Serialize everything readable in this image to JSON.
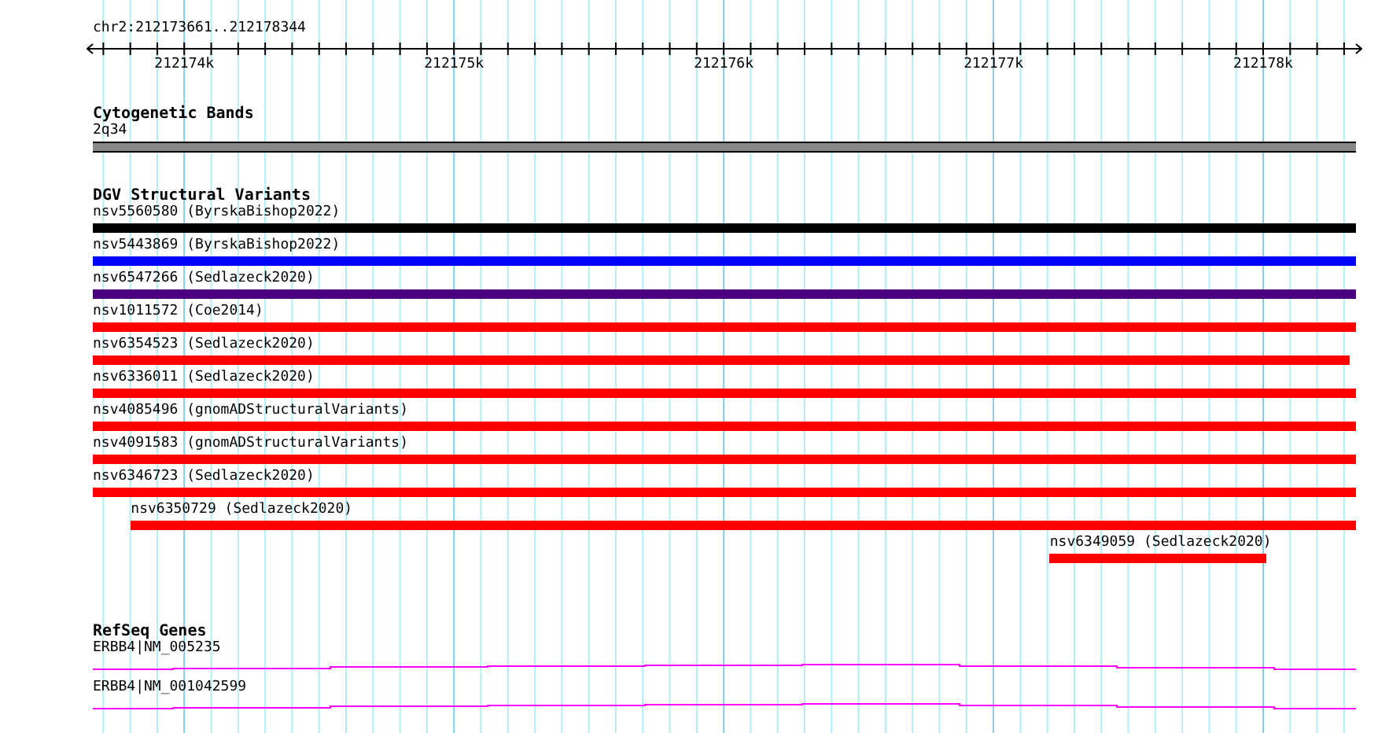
{
  "ruler": {
    "location": "chr2:212173661..212178344",
    "tick_labels": [
      "212174k",
      "212175k",
      "212176k",
      "212177k",
      "212178k"
    ]
  },
  "cytogenetic_bands": {
    "title": "Cytogenetic Bands",
    "band": "2q34"
  },
  "dgv_track": {
    "title": "DGV Structural Variants",
    "variants": [
      {
        "label": "nsv5560580 (ByrskaBishop2022)",
        "color": "#000000"
      },
      {
        "label": "nsv5443869 (ByrskaBishop2022)",
        "color": "#0000ff"
      },
      {
        "label": "nsv6547266 (Sedlazeck2020)",
        "color": "#4b0082"
      },
      {
        "label": "nsv1011572 (Coe2014)",
        "color": "#ff0000"
      },
      {
        "label": "nsv6354523 (Sedlazeck2020)",
        "color": "#ff0000"
      },
      {
        "label": "nsv6336011 (Sedlazeck2020)",
        "color": "#ff0000"
      },
      {
        "label": "nsv4085496 (gnomADStructuralVariants)",
        "color": "#ff0000"
      },
      {
        "label": "nsv4091583 (gnomADStructuralVariants)",
        "color": "#ff0000"
      },
      {
        "label": "nsv6346723 (Sedlazeck2020)",
        "color": "#ff0000"
      },
      {
        "label": "nsv6350729 (Sedlazeck2020)",
        "color": "#ff0000"
      },
      {
        "label": "nsv6349059 (Sedlazeck2020)",
        "color": "#ff0000"
      }
    ]
  },
  "refseq_genes": {
    "title": "RefSeq Genes",
    "genes": [
      {
        "label": "ERBB4|NM_005235"
      },
      {
        "label": "ERBB4|NM_001042599"
      }
    ]
  }
}
